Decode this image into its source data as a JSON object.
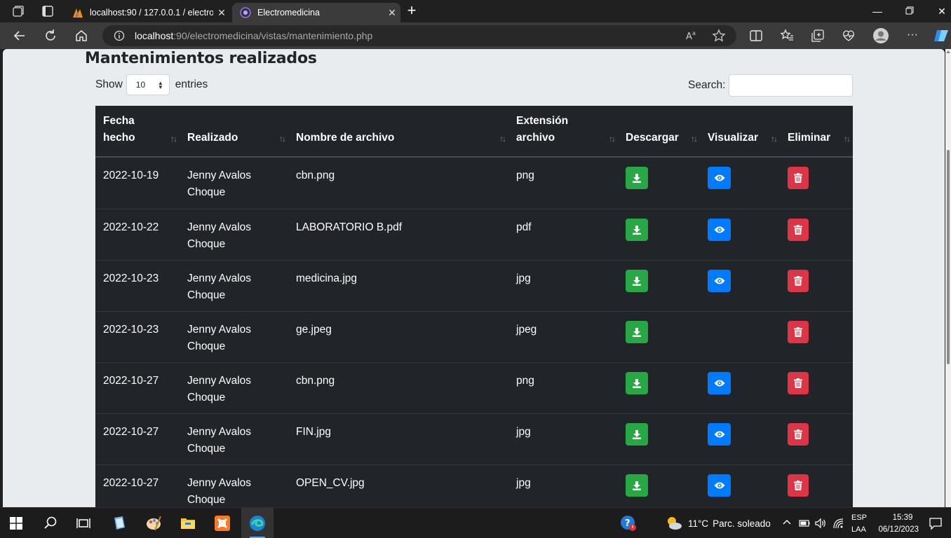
{
  "browser": {
    "tabs": [
      {
        "title": "localhost:90 / 127.0.0.1 / electromedicina",
        "active": false
      },
      {
        "title": "Electromedicina",
        "active": true
      }
    ],
    "url_host": "localhost",
    "url_rest": ":90/electromedicina/vistas/mantenimiento.php"
  },
  "page": {
    "heading": "Mantenimientos realizados",
    "length": {
      "show": "Show",
      "value": "10",
      "entries": "entries"
    },
    "search_label": "Search:"
  },
  "table": {
    "columns": [
      "Fecha hecho",
      "Realizado",
      "Nombre de archivo",
      "Extensión archivo",
      "Descargar",
      "Visualizar",
      "Eliminar"
    ],
    "rows": [
      {
        "fecha": "2022-10-19",
        "realizado": "Jenny Avalos Choque",
        "archivo": "cbn.png",
        "ext": "png",
        "view": true
      },
      {
        "fecha": "2022-10-22",
        "realizado": "Jenny Avalos Choque",
        "archivo": "LABORATORIO B.pdf",
        "ext": "pdf",
        "view": true
      },
      {
        "fecha": "2022-10-23",
        "realizado": "Jenny Avalos Choque",
        "archivo": "medicina.jpg",
        "ext": "jpg",
        "view": true
      },
      {
        "fecha": "2022-10-23",
        "realizado": "Jenny Avalos Choque",
        "archivo": "ge.jpeg",
        "ext": "jpeg",
        "view": false
      },
      {
        "fecha": "2022-10-27",
        "realizado": "Jenny Avalos Choque",
        "archivo": "cbn.png",
        "ext": "png",
        "view": true
      },
      {
        "fecha": "2022-10-27",
        "realizado": "Jenny Avalos Choque",
        "archivo": "FIN.jpg",
        "ext": "jpg",
        "view": true
      },
      {
        "fecha": "2022-10-27",
        "realizado": "Jenny Avalos Choque",
        "archivo": "OPEN_CV.jpg",
        "ext": "jpg",
        "view": true
      }
    ]
  },
  "colors": {
    "download": "#28a745",
    "view": "#007bff",
    "delete": "#dc3545",
    "table_bg": "#212529"
  },
  "taskbar": {
    "weather_temp": "11°C",
    "weather_text": "Parc. soleado",
    "lang_top": "ESP",
    "lang_bottom": "LAA",
    "time": "15:39",
    "date": "06/12/2023"
  }
}
